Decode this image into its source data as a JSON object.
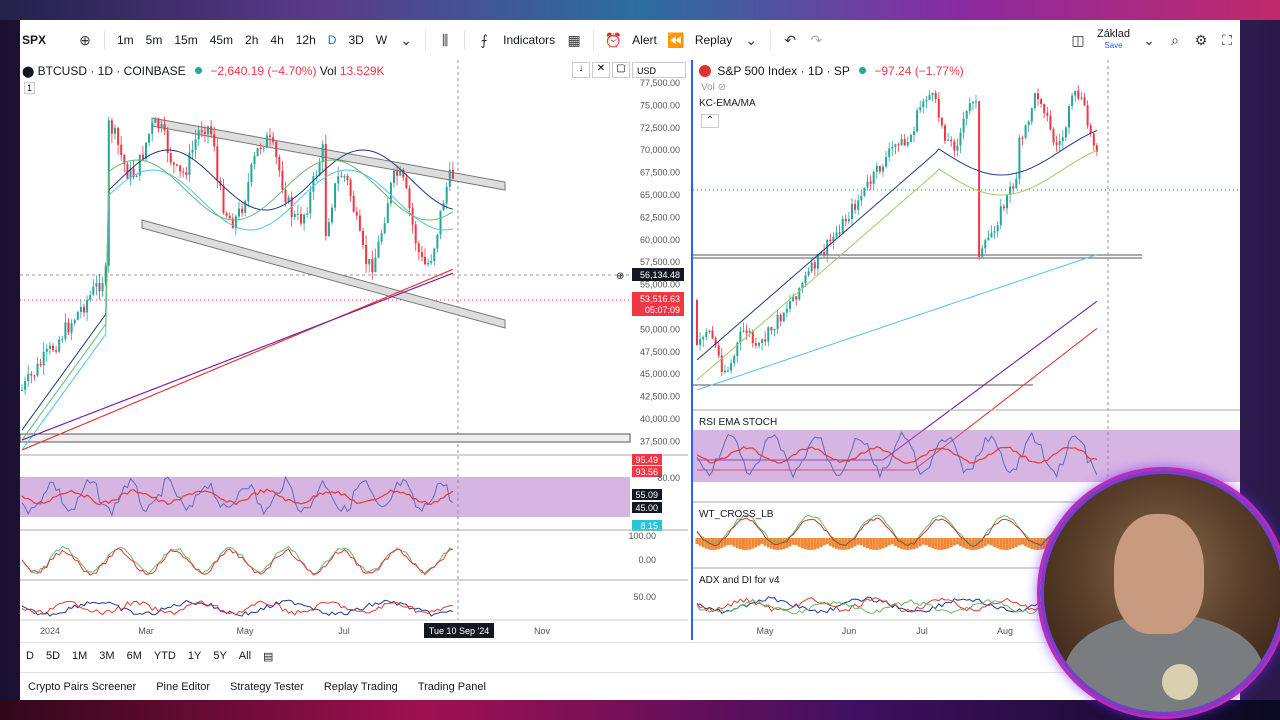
{
  "toolbar": {
    "symbol": "SPX",
    "intervals": [
      "1m",
      "5m",
      "15m",
      "45m",
      "2h",
      "4h",
      "12h",
      "D",
      "3D",
      "W"
    ],
    "active_interval": "D",
    "indicators_label": "Indicators",
    "alert_label": "Alert",
    "replay_label": "Replay",
    "layout_name": "Základ",
    "layout_sub": "Save"
  },
  "left_chart": {
    "pane_index": "1",
    "title": "BTCUSD · 1D · COINBASE",
    "change": "−2,640.19 (−4.70%)",
    "volume_label": "Vol",
    "volume": "13.529K",
    "currency": "USD",
    "price_axis": [
      "77,500.00",
      "75,000.00",
      "72,500.00",
      "70,000.00",
      "67,500.00",
      "65,000.00",
      "62,500.00",
      "60,000.00",
      "57,500.00",
      "55,000.00",
      "52,500.00",
      "50,000.00",
      "47,500.00",
      "45,000.00",
      "42,500.00",
      "40,000.00",
      "37,500.00"
    ],
    "crosshair_price": "56,134.48",
    "last_price": "53,516.63",
    "countdown": "05:07:09",
    "rsi_badges": [
      "95.49",
      "93.56",
      "55.09",
      "45.00"
    ],
    "rsi_axis": [
      "80.00"
    ],
    "stoch_badge": "8.15",
    "osc_axis": [
      "100.00",
      "0.00",
      "50.00"
    ],
    "time_axis": [
      "2024",
      "Mar",
      "May",
      "Jul",
      "Nov"
    ],
    "crosshair_date": "Tue 10 Sep '24",
    "colors": {
      "up": "#26a69a",
      "down": "#f23645",
      "accent": "#2962ff"
    }
  },
  "right_chart": {
    "title": "S&P 500 Index · 1D · SP",
    "change": "−97.24 (−1.77%)",
    "vol_label": "Vol",
    "indicator_main": "KC-EMA/MA",
    "rsi_label": "RSI EMA STOCH",
    "wt_label": "WT_CROSS_LB",
    "adx_label": "ADX and DI for v4",
    "time_axis": [
      "May",
      "Jun",
      "Jul",
      "Aug"
    ]
  },
  "range_bar": [
    "D",
    "5D",
    "1M",
    "3M",
    "6M",
    "YTD",
    "1Y",
    "5Y",
    "All"
  ],
  "panel_bar": [
    "Crypto Pairs Screener",
    "Pine Editor",
    "Strategy Tester",
    "Replay Trading",
    "Trading Panel"
  ]
}
